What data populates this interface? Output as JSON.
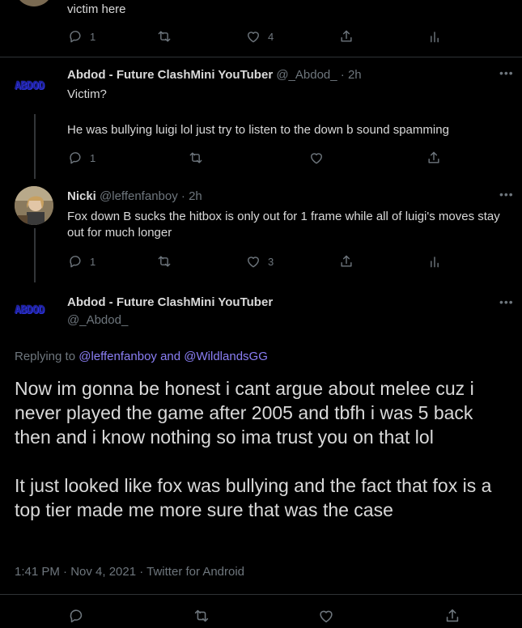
{
  "tweet0": {
    "text": "victim here",
    "reply_count": "1",
    "like_count": "4"
  },
  "tweet1": {
    "avatar_text": "ABDOD",
    "name": "Abdod - Future ClashMini YouTuber",
    "handle": "@_Abdod_",
    "time": "2h",
    "line1": "Victim?",
    "line2": "He was bullying luigi lol just try to listen to the down b sound spamming",
    "reply_count": "1"
  },
  "tweet2": {
    "name": "Nicki",
    "handle": "@leffenfanboy",
    "time": "2h",
    "text": "Fox down B sucks the hitbox is only out for 1 frame while all of luigi's moves stay out for much longer",
    "reply_count": "1",
    "like_count": "3"
  },
  "main_tweet": {
    "avatar_text": "ABDOD",
    "name": "Abdod - Future ClashMini YouTuber",
    "handle": "@_Abdod_",
    "replying_prefix": "Replying to",
    "mention1": "@leffenfanboy",
    "and": "and",
    "mention2": "@WildlandsGG",
    "para1": "Now im gonna be honest i cant argue about melee cuz i never played the game after 2005 and tbfh i was 5 back then and i know nothing so ima trust you on that lol",
    "para2": "It just looked like fox was bullying and the fact that fox is a top tier made me more sure that was the case",
    "timestamp": "1:41 PM · Nov 4, 2021 · Twitter for Android"
  },
  "icons": {
    "reply": "reply-icon",
    "retweet": "retweet-icon",
    "like": "heart-icon",
    "share": "share-icon",
    "analytics": "analytics-icon",
    "more": "more-icon"
  },
  "colors": {
    "background": "#000000",
    "text": "#d9d9d9",
    "muted": "#6e767d",
    "mention": "#8b7ff5"
  }
}
